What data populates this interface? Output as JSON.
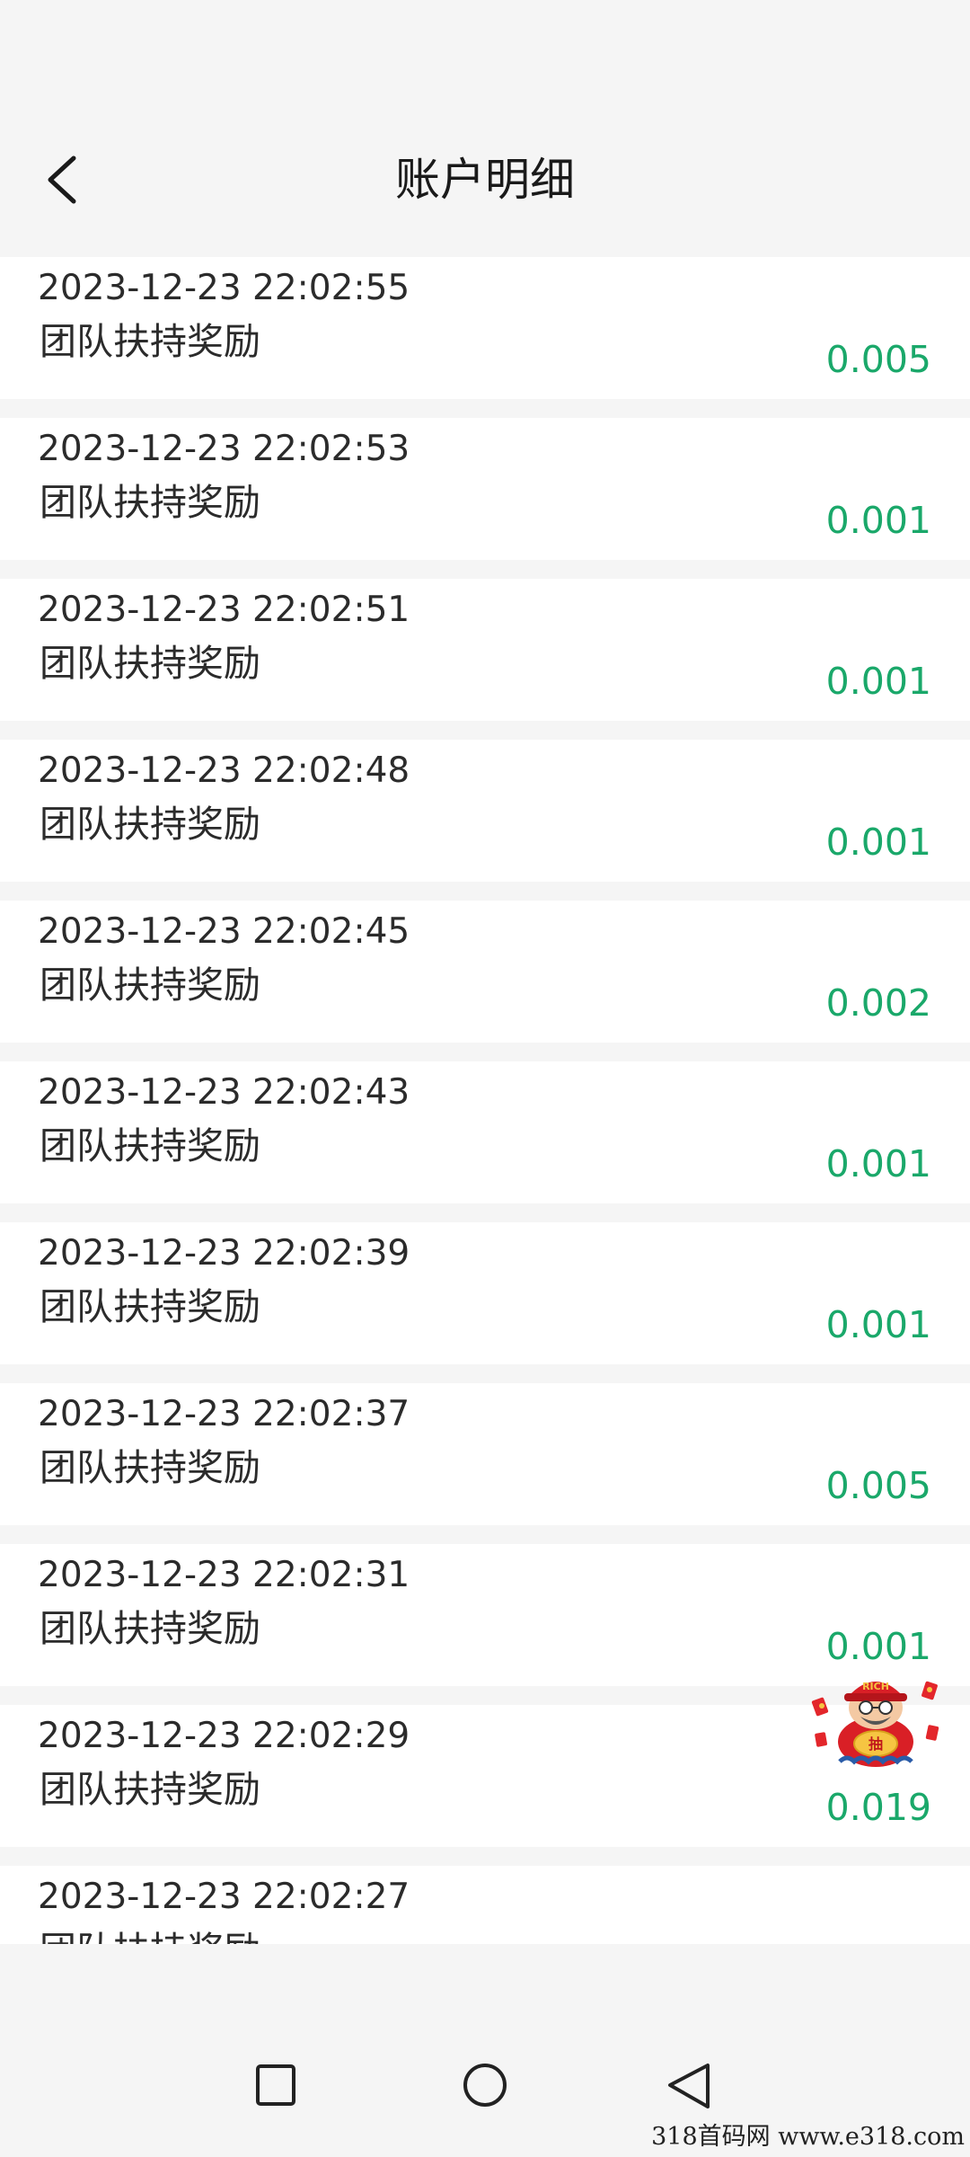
{
  "header": {
    "title": "账户明细",
    "back_icon": "chevron-left-icon"
  },
  "colors": {
    "background": "#f5f5f5",
    "row_background": "#ffffff",
    "text": "#2b2b2b",
    "amount": "#1aa86a"
  },
  "records": [
    {
      "time": "2023-12-23 22:02:55",
      "desc": "团队扶持奖励",
      "amount": "0.005"
    },
    {
      "time": "2023-12-23 22:02:53",
      "desc": "团队扶持奖励",
      "amount": "0.001"
    },
    {
      "time": "2023-12-23 22:02:51",
      "desc": "团队扶持奖励",
      "amount": "0.001"
    },
    {
      "time": "2023-12-23 22:02:48",
      "desc": "团队扶持奖励",
      "amount": "0.001"
    },
    {
      "time": "2023-12-23 22:02:45",
      "desc": "团队扶持奖励",
      "amount": "0.002"
    },
    {
      "time": "2023-12-23 22:02:43",
      "desc": "团队扶持奖励",
      "amount": "0.001"
    },
    {
      "time": "2023-12-23 22:02:39",
      "desc": "团队扶持奖励",
      "amount": "0.001"
    },
    {
      "time": "2023-12-23 22:02:37",
      "desc": "团队扶持奖励",
      "amount": "0.005"
    },
    {
      "time": "2023-12-23 22:02:31",
      "desc": "团队扶持奖励",
      "amount": "0.001"
    },
    {
      "time": "2023-12-23 22:02:29",
      "desc": "团队扶持奖励",
      "amount": "0.019"
    },
    {
      "time": "2023-12-23 22:02:27",
      "desc": "团队扶持奖励",
      "amount": ""
    }
  ],
  "floating_badge": {
    "icon": "god-of-wealth-lucky-draw-icon",
    "hat_text": "RICH",
    "ingot_text": "抽"
  },
  "navbar": {
    "recents_icon": "square-icon",
    "home_icon": "circle-icon",
    "back_icon": "triangle-back-icon"
  },
  "watermark": "318首码网  www.e318.com"
}
